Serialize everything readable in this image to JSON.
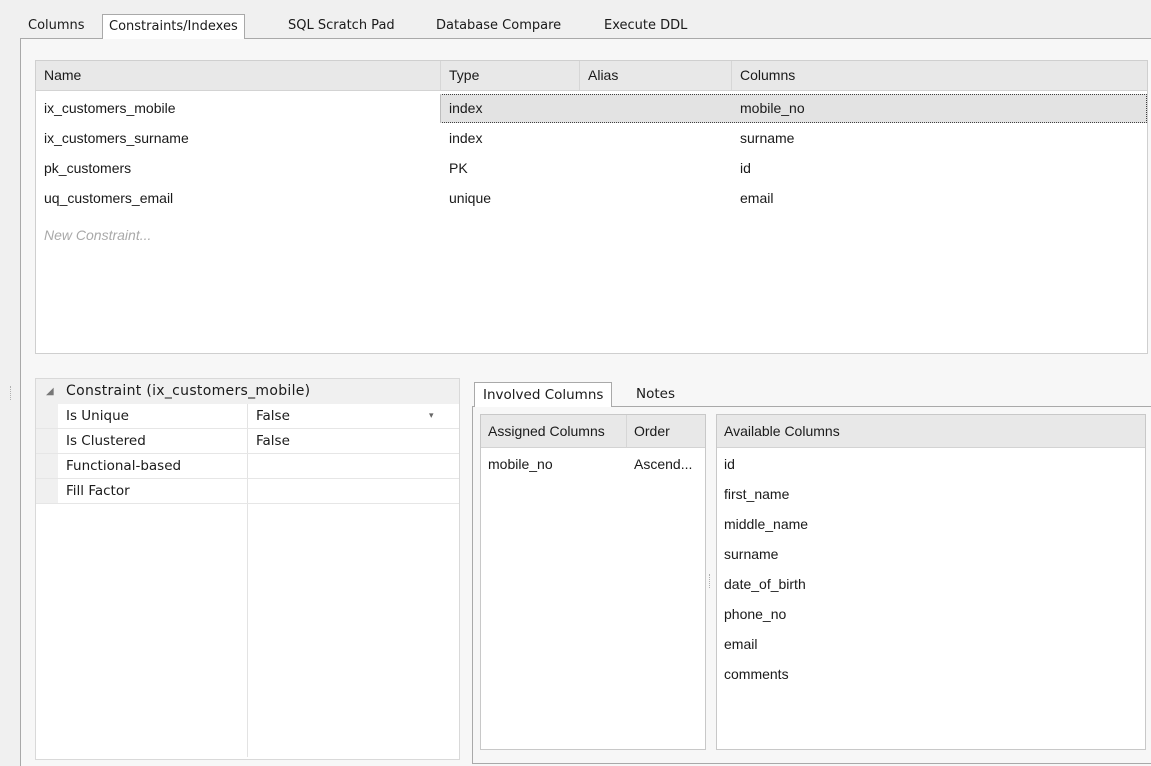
{
  "tabs": [
    {
      "label": "Columns",
      "active": false
    },
    {
      "label": "Constraints/Indexes",
      "active": true
    },
    {
      "label": "SQL Scratch Pad",
      "active": false
    },
    {
      "label": "Database Compare",
      "active": false
    },
    {
      "label": "Execute DDL",
      "active": false
    }
  ],
  "constraints_grid": {
    "headers": [
      "Name",
      "Type",
      "Alias",
      "Columns"
    ],
    "rows": [
      {
        "name": "ix_customers_mobile",
        "type": "index",
        "alias": "",
        "columns": "mobile_no",
        "selected": true
      },
      {
        "name": "ix_customers_surname",
        "type": "index",
        "alias": "",
        "columns": "surname",
        "selected": false
      },
      {
        "name": "pk_customers",
        "type": "PK",
        "alias": "",
        "columns": "id",
        "selected": false
      },
      {
        "name": "uq_customers_email",
        "type": "unique",
        "alias": "",
        "columns": "email",
        "selected": false
      }
    ],
    "new_placeholder": "New Constraint..."
  },
  "properties": {
    "group_label": "Constraint (ix_customers_mobile)",
    "rows": [
      {
        "label": "Is Unique",
        "value": "False",
        "has_dropdown": true
      },
      {
        "label": "Is Clustered",
        "value": "False",
        "has_dropdown": false
      },
      {
        "label": "Functional-based",
        "value": "",
        "has_dropdown": false
      },
      {
        "label": "Fill Factor",
        "value": "",
        "has_dropdown": false
      }
    ]
  },
  "sub_tabs": [
    {
      "label": "Involved Columns",
      "active": true
    },
    {
      "label": "Notes",
      "active": false
    }
  ],
  "assigned": {
    "headers": [
      "Assigned Columns",
      "Order"
    ],
    "rows": [
      {
        "column": "mobile_no",
        "order": "Ascend..."
      }
    ]
  },
  "available": {
    "header": "Available Columns",
    "items": [
      "id",
      "first_name",
      "middle_name",
      "surname",
      "date_of_birth",
      "phone_no",
      "email",
      "comments"
    ]
  }
}
